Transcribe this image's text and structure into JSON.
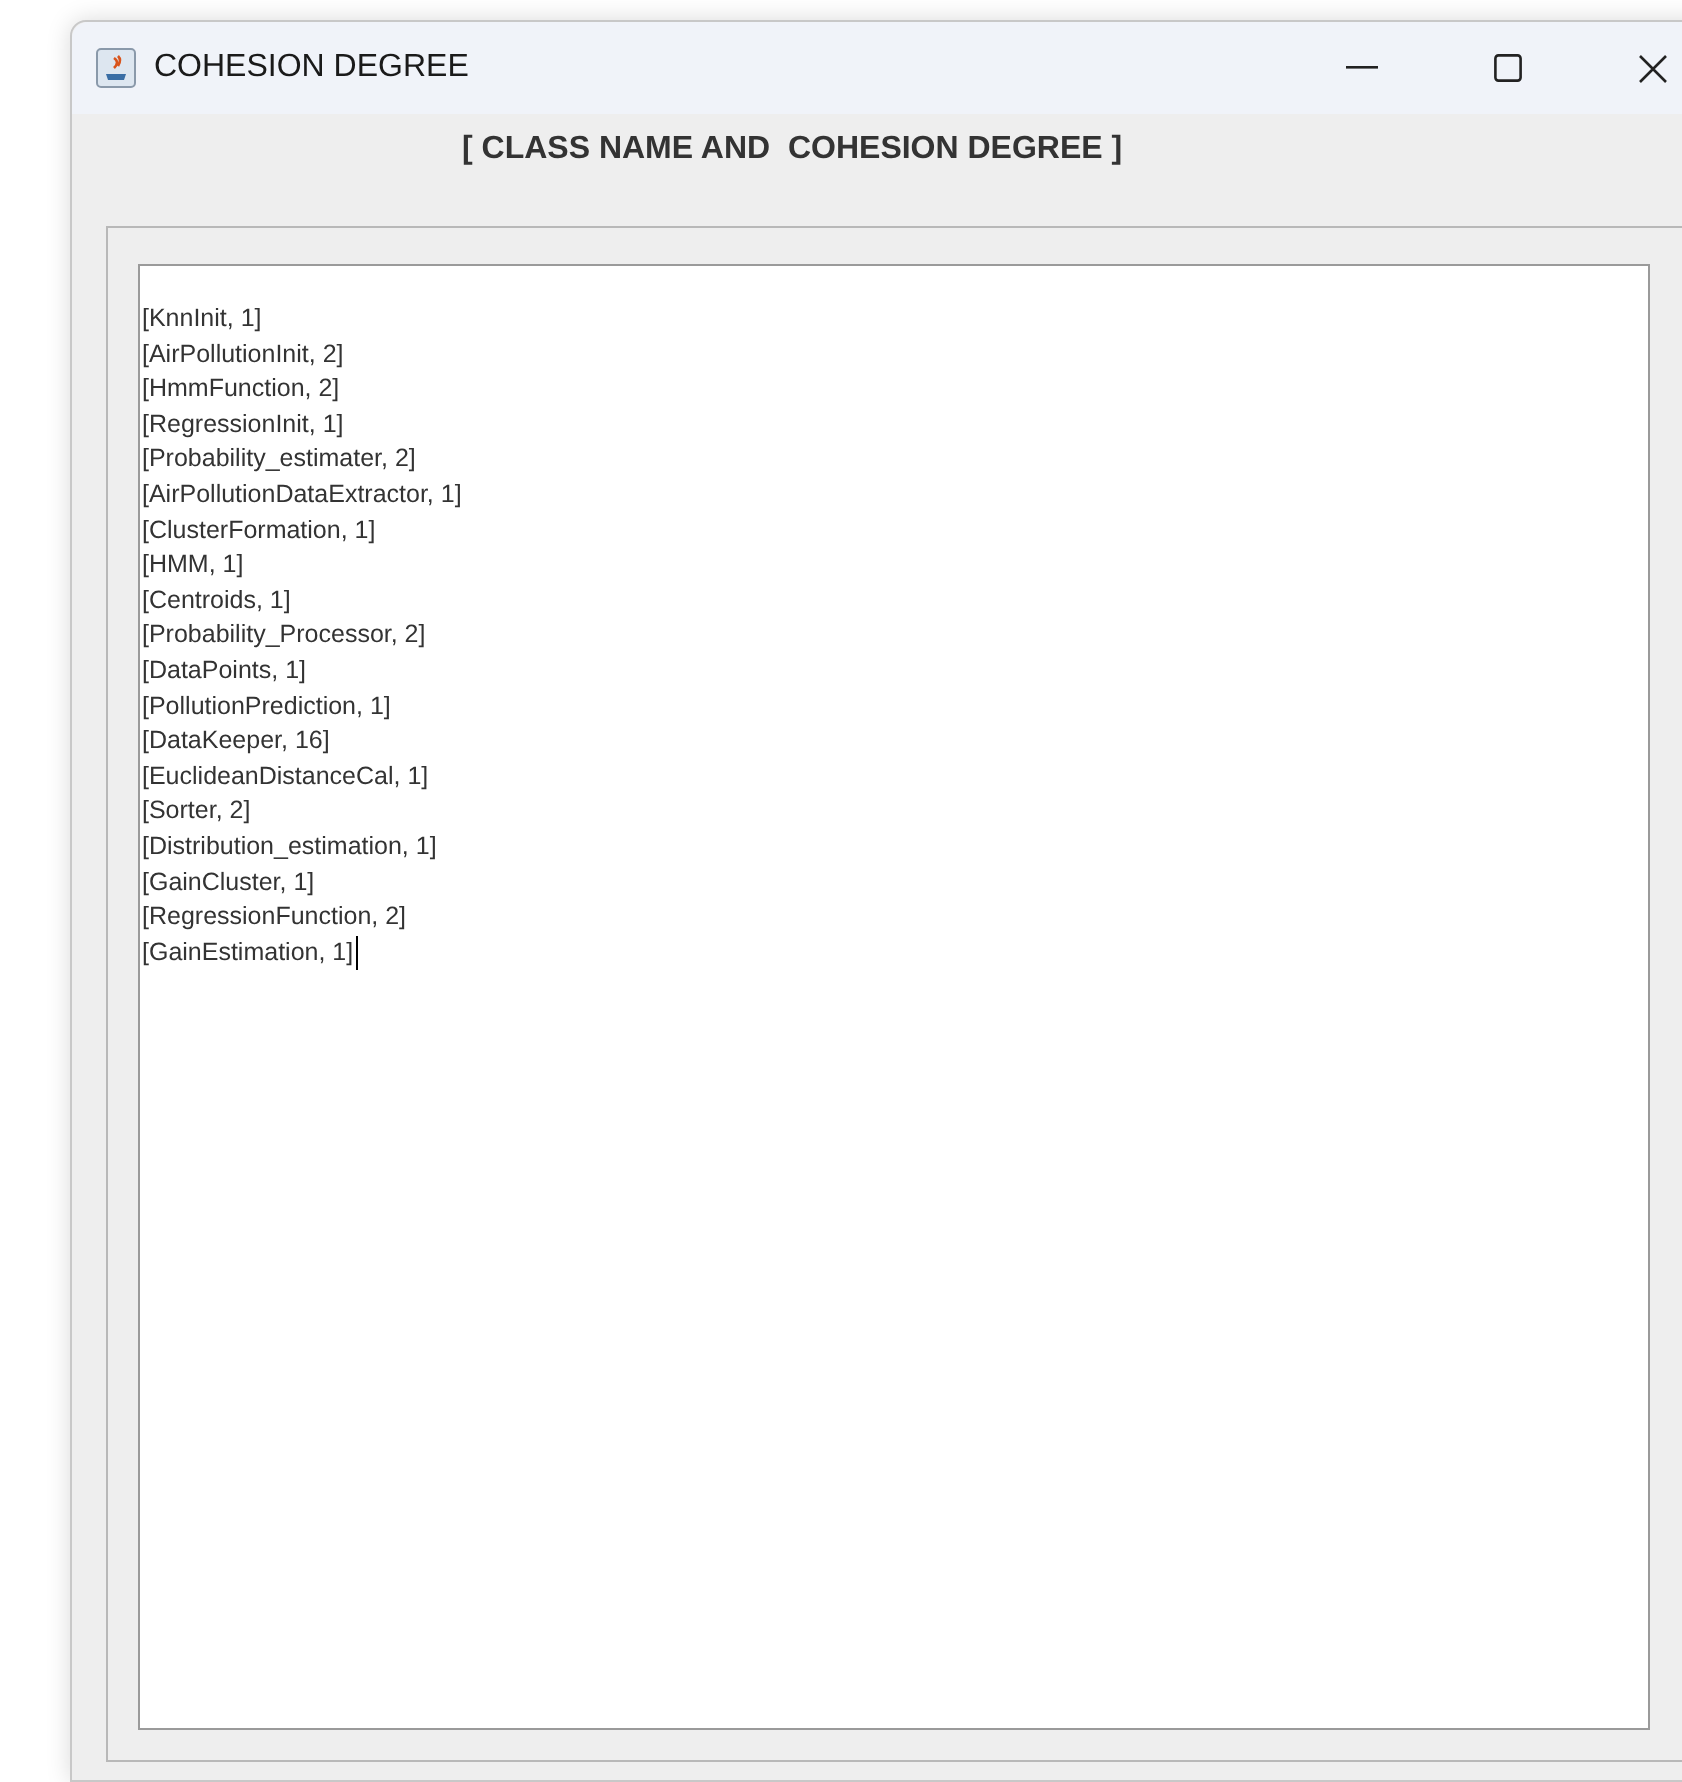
{
  "window": {
    "title": "COHESION DEGREE"
  },
  "heading": "[ CLASS NAME AND  COHESION DEGREE ]",
  "text_area": {
    "lines": [
      "[KnnInit, 1]",
      "[AirPollutionInit, 2]",
      "[HmmFunction, 2]",
      "[RegressionInit, 1]",
      "[Probability_estimater, 2]",
      "[AirPollutionDataExtractor, 1]",
      "[ClusterFormation, 1]",
      "[HMM, 1]",
      "[Centroids, 1]",
      "[Probability_Processor, 2]",
      "[DataPoints, 1]",
      "[PollutionPrediction, 1]",
      "[DataKeeper, 16]",
      "[EuclideanDistanceCal, 1]",
      "[Sorter, 2]",
      "[Distribution_estimation, 1]",
      "[GainCluster, 1]",
      "[RegressionFunction, 2]",
      "[GainEstimation, 1]"
    ]
  }
}
